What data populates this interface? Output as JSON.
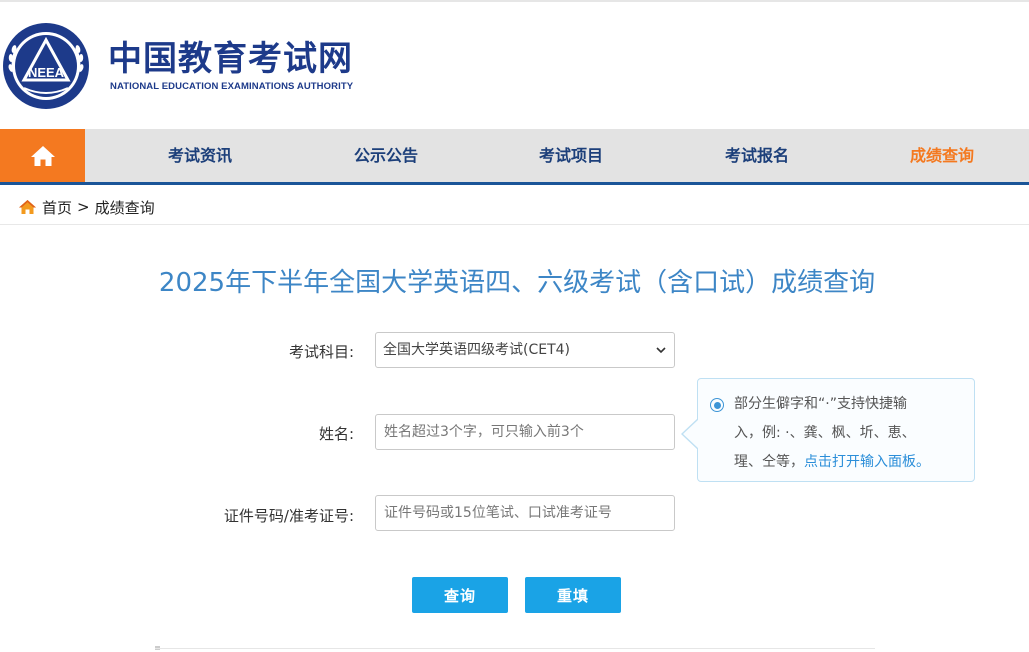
{
  "header": {
    "logo_cn": "中国教育考试网",
    "logo_en": "NATIONAL EDUCATION EXAMINATIONS AUTHORITY",
    "seal_text": "NEEA",
    "brand_color": "#1d3a8a"
  },
  "nav": {
    "home_icon": "home-icon",
    "items": [
      {
        "label": "考试资讯"
      },
      {
        "label": "公示公告"
      },
      {
        "label": "考试项目"
      },
      {
        "label": "考试报名"
      },
      {
        "label": "成绩查询",
        "active": true
      }
    ],
    "accent_color": "#f47920"
  },
  "breadcrumb": {
    "home": "首页",
    "separator": ">",
    "current": "成绩查询"
  },
  "page": {
    "title": "2025年下半年全国大学英语四、六级考试（含口试）成绩查询"
  },
  "form": {
    "subject_label": "考试科目:",
    "subject_value": "全国大学英语四级考试(CET4)",
    "name_label": "姓名:",
    "name_placeholder": "姓名超过3个字，可只输入前3个",
    "id_label": "证件号码/准考证号:",
    "id_placeholder": "证件号码或15位笔试、口试准考证号"
  },
  "tip": {
    "line1": "部分生僻字和“·”支持快捷输",
    "line2": "入，例: ·、龚、枫、圻、恵、",
    "line3_text": "瑆、仝等，",
    "line3_link": "点击打开输入面板。"
  },
  "buttons": {
    "query": "查询",
    "reset": "重填",
    "color": "#1aa3e6"
  }
}
